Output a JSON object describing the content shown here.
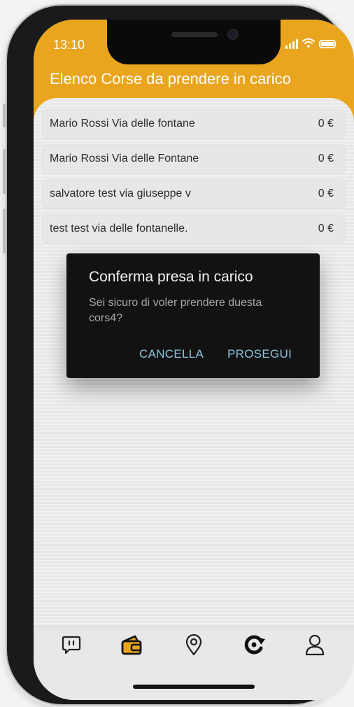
{
  "status_bar": {
    "time": "13:10"
  },
  "header": {
    "title": "Elenco Corse da prendere in carico",
    "color": "#eaa51f"
  },
  "rides": [
    {
      "label": "Mario Rossi Via delle fontane",
      "price": "0 €"
    },
    {
      "label": "Mario Rossi Via delle Fontane",
      "price": "0 €"
    },
    {
      "label": "salvatore test via giuseppe v",
      "price": "0 €"
    },
    {
      "label": "test test via delle fontanelle.",
      "price": "0 €"
    }
  ],
  "dialog": {
    "title": "Conferma presa in carico",
    "message": "Sei sicuro di voler prendere duesta cors4?",
    "cancel_label": "CANCELLA",
    "confirm_label": "PROSEGUI",
    "button_color": "#8ec3e0"
  },
  "tabbar": {
    "items": [
      {
        "icon": "chat-icon"
      },
      {
        "icon": "wallet-icon",
        "active": true
      },
      {
        "icon": "location-pin-icon"
      },
      {
        "icon": "refresh-icon"
      },
      {
        "icon": "user-icon"
      }
    ]
  }
}
